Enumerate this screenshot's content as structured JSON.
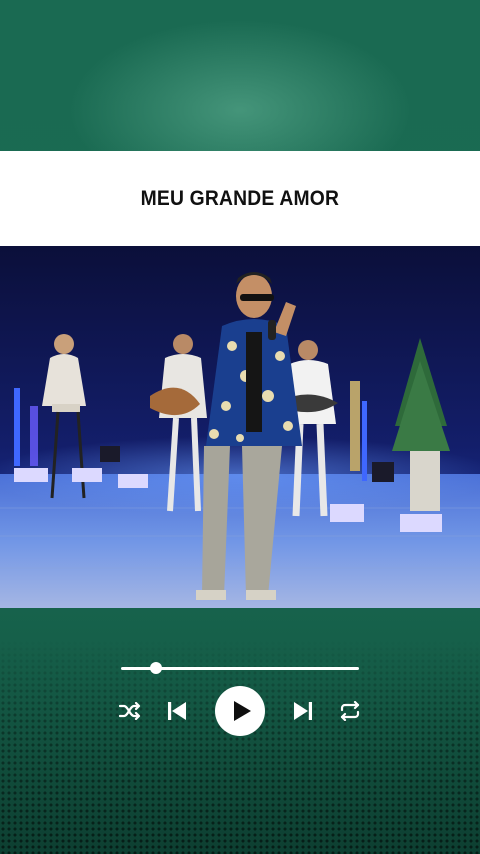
{
  "song": {
    "title": "MEU GRANDE AMOR"
  },
  "player": {
    "progress": 0.146,
    "state": "paused",
    "controls": [
      "shuffle-icon",
      "skip-previous-icon",
      "play-icon",
      "skip-next-icon",
      "repeat-icon"
    ]
  },
  "colors": {
    "background": "#1b6c53",
    "title_bar": "#ffffff",
    "title_text": "#111111",
    "controls": "#ffffff"
  }
}
